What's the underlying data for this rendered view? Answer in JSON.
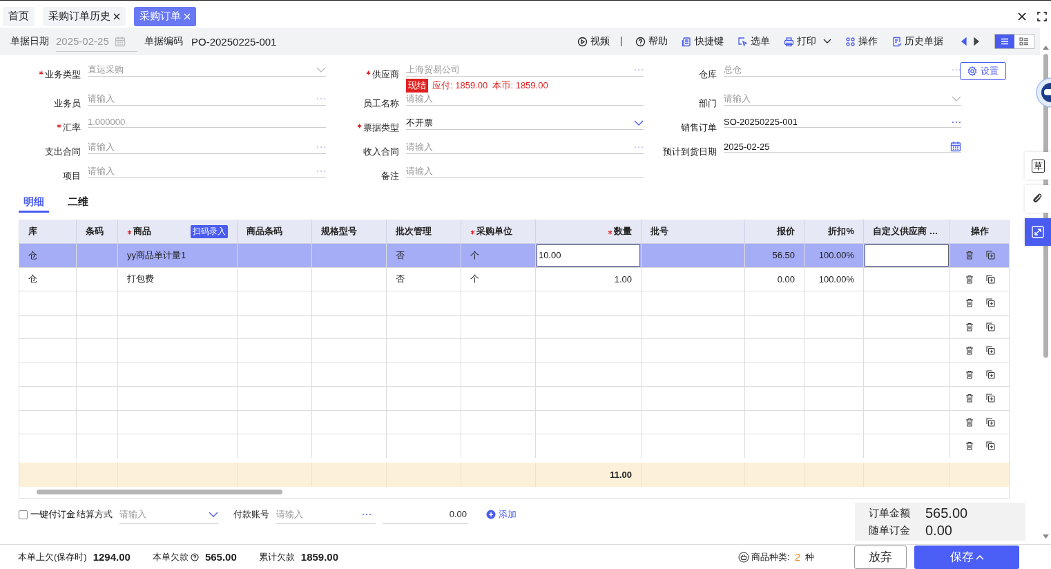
{
  "top_tabs": [
    {
      "label": "首页",
      "closable": false,
      "selected": false
    },
    {
      "label": "采购订单历史",
      "closable": true,
      "selected": false
    },
    {
      "label": "采购订单",
      "closable": true,
      "selected": true
    }
  ],
  "header": {
    "date_label": "单据日期",
    "date_value": "2025-02-25",
    "code_label": "单据编码",
    "code_value": "PO-20250225-001"
  },
  "toolbar": [
    {
      "kind": "video",
      "label": "视频"
    },
    {
      "kind": "help",
      "label": "帮助"
    },
    {
      "kind": "shortcut",
      "label": "快捷键"
    },
    {
      "kind": "pick",
      "label": "选单"
    },
    {
      "kind": "print",
      "label": "打印"
    },
    {
      "kind": "ops",
      "label": "操作"
    },
    {
      "kind": "history",
      "label": "历史单据"
    }
  ],
  "view_modes": [
    {
      "kind": "list",
      "selected": true
    },
    {
      "kind": "detail",
      "selected": false
    }
  ],
  "settings_button": "设置",
  "fields": [
    {
      "label": "业务类型",
      "required": true,
      "kind": "select",
      "value": "直运采购",
      "disabled": true
    },
    {
      "label": "供应商",
      "required": true,
      "kind": "lookup",
      "value": "上海贸易公司",
      "disabled": true,
      "badge": {
        "tag": "现结",
        "note": "应付: 1859.00  本币: 1859.00"
      }
    },
    {
      "label": "仓库",
      "required": false,
      "kind": "lookup",
      "value": "总仓",
      "disabled": true
    },
    {
      "label": "业务员",
      "required": false,
      "kind": "lookup",
      "placeholder": "请输入"
    },
    {
      "label": "员工名称",
      "required": false,
      "kind": "text",
      "placeholder": "请输入"
    },
    {
      "label": "部门",
      "required": false,
      "kind": "select",
      "placeholder": "请输入"
    },
    {
      "label": "汇率",
      "required": true,
      "kind": "text",
      "value": "1.000000",
      "disabled": true
    },
    {
      "label": "票据类型",
      "required": true,
      "kind": "select",
      "value": "不开票",
      "disabled": false
    },
    {
      "label": "销售订单",
      "required": false,
      "kind": "lookup",
      "value": "SO-20250225-001",
      "disabled": false
    },
    {
      "label": "支出合同",
      "required": false,
      "kind": "lookup",
      "placeholder": "请输入"
    },
    {
      "label": "收入合同",
      "required": false,
      "kind": "lookup",
      "placeholder": "请输入"
    },
    {
      "label": "预计到货日期",
      "required": false,
      "kind": "date",
      "value": "2025-02-25",
      "disabled": false
    },
    {
      "label": "项目",
      "required": false,
      "kind": "lookup",
      "placeholder": "请输入"
    },
    {
      "label": "备注",
      "required": false,
      "kind": "text",
      "placeholder": "请输入"
    }
  ],
  "detail_tabs": [
    {
      "label": "明细",
      "selected": true
    },
    {
      "label": "二维",
      "selected": false
    }
  ],
  "table": {
    "columns": [
      {
        "label": "库",
        "required": false,
        "kind": "text"
      },
      {
        "label": "条码",
        "required": false,
        "kind": "text"
      },
      {
        "label": "商品",
        "required": true,
        "kind": "text",
        "scan_button": "扫码录入"
      },
      {
        "label": "商品条码",
        "required": false,
        "kind": "text"
      },
      {
        "label": "规格型号",
        "required": false,
        "kind": "text"
      },
      {
        "label": "批次管理",
        "required": false,
        "kind": "text"
      },
      {
        "label": "采购单位",
        "required": true,
        "kind": "text"
      },
      {
        "label": "数量",
        "required": true,
        "kind": "number"
      },
      {
        "label": "批号",
        "required": false,
        "kind": "text"
      },
      {
        "label": "报价",
        "required": false,
        "kind": "number"
      },
      {
        "label": "折扣%",
        "required": false,
        "kind": "number"
      },
      {
        "label": "自定义供应商 …",
        "required": false,
        "kind": "text"
      },
      {
        "label": "操作",
        "required": false,
        "kind": "ops"
      }
    ],
    "rows": [
      {
        "selected": true,
        "warehouse": "仓",
        "product": "yy商品单计量1",
        "batch": "否",
        "unit": "个",
        "quantity": "10.00",
        "price": "56.50",
        "discount": "100.00%"
      },
      {
        "selected": false,
        "warehouse": "仓",
        "product": "打包费",
        "batch": "否",
        "unit": "个",
        "quantity": "1.00",
        "price": "0.00",
        "discount": "100.00%"
      }
    ],
    "total": {
      "quantity": "11.00"
    }
  },
  "payment": {
    "deposit": {
      "label": "一键付订金",
      "checked": false
    },
    "method_label": "结算方式",
    "method_placeholder": "请输入",
    "account_label": "付款账号",
    "account_placeholder": "请输入",
    "amount": "0.00",
    "add_link": "添加"
  },
  "summary": [
    {
      "label": "订单金额",
      "value": "565.00"
    },
    {
      "label": "随单订金",
      "value": "0.00"
    }
  ],
  "status_bar": {
    "items": [
      {
        "label": "本单上欠(保存时)",
        "value": "1294.00",
        "help": false
      },
      {
        "label": "本单欠款",
        "value": "565.00",
        "help": true
      },
      {
        "label": "累计欠款",
        "value": "1859.00",
        "help": false
      }
    ],
    "types_label": "商品种类:",
    "types_count": "2",
    "types_unit": "种"
  },
  "buttons": [
    {
      "kind": "secondary",
      "label": "放弃"
    },
    {
      "kind": "primary",
      "label": "保存"
    }
  ],
  "right_rail": {
    "draft_label": "草"
  }
}
